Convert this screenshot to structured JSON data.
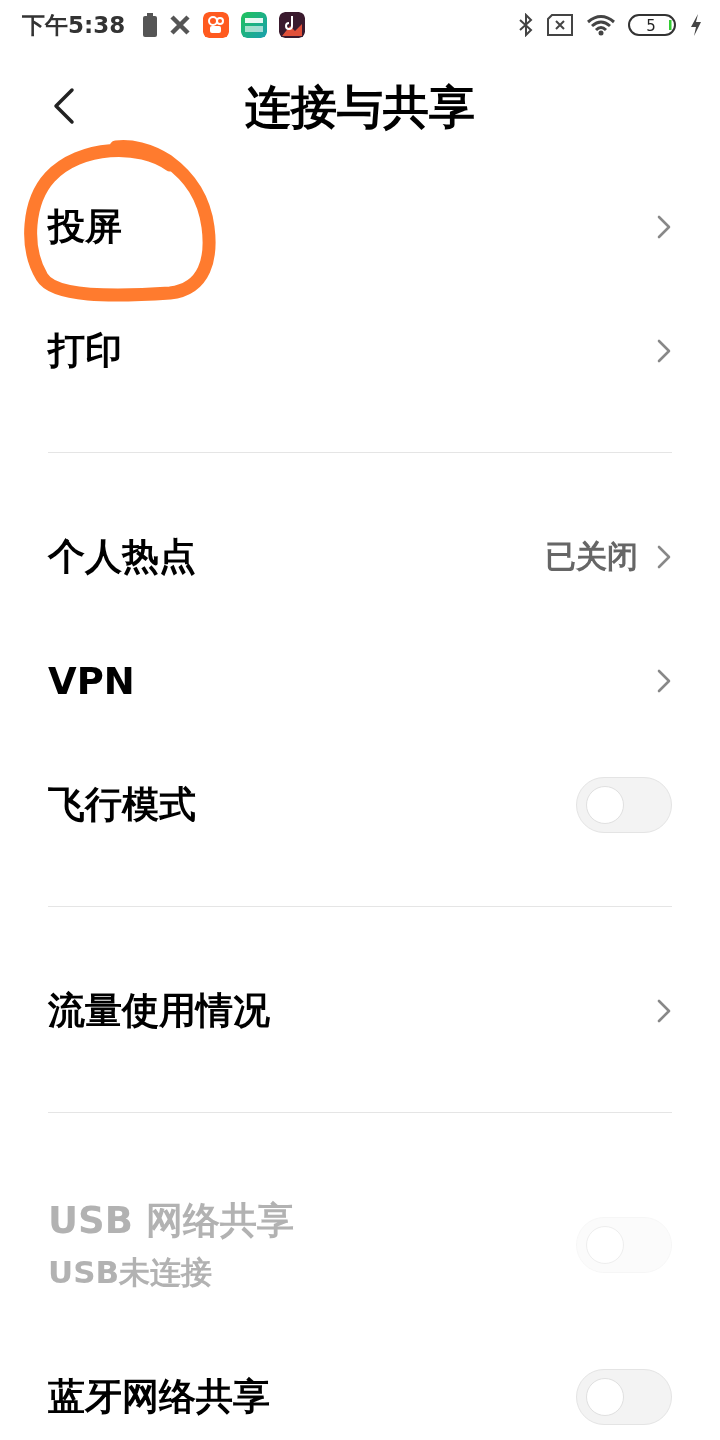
{
  "status_bar": {
    "time": "下午5:38",
    "battery_percent": "5"
  },
  "header": {
    "title": "连接与共享"
  },
  "sections": [
    {
      "items": [
        {
          "kind": "link",
          "title": "投屏",
          "circled": true
        },
        {
          "kind": "link",
          "title": "打印",
          "circled": false
        }
      ]
    },
    {
      "items": [
        {
          "kind": "link",
          "title": "个人热点",
          "value": "已关闭"
        },
        {
          "kind": "link",
          "title": "VPN"
        },
        {
          "kind": "toggle",
          "title": "飞行模式",
          "on": false,
          "disabled": false
        }
      ]
    },
    {
      "items": [
        {
          "kind": "link",
          "title": "流量使用情况"
        }
      ]
    },
    {
      "items": [
        {
          "kind": "toggle",
          "title": "USB 网络共享",
          "subtitle": "USB未连接",
          "on": false,
          "disabled": true
        },
        {
          "kind": "toggle",
          "title": "蓝牙网络共享",
          "on": false,
          "disabled": false
        }
      ]
    }
  ]
}
